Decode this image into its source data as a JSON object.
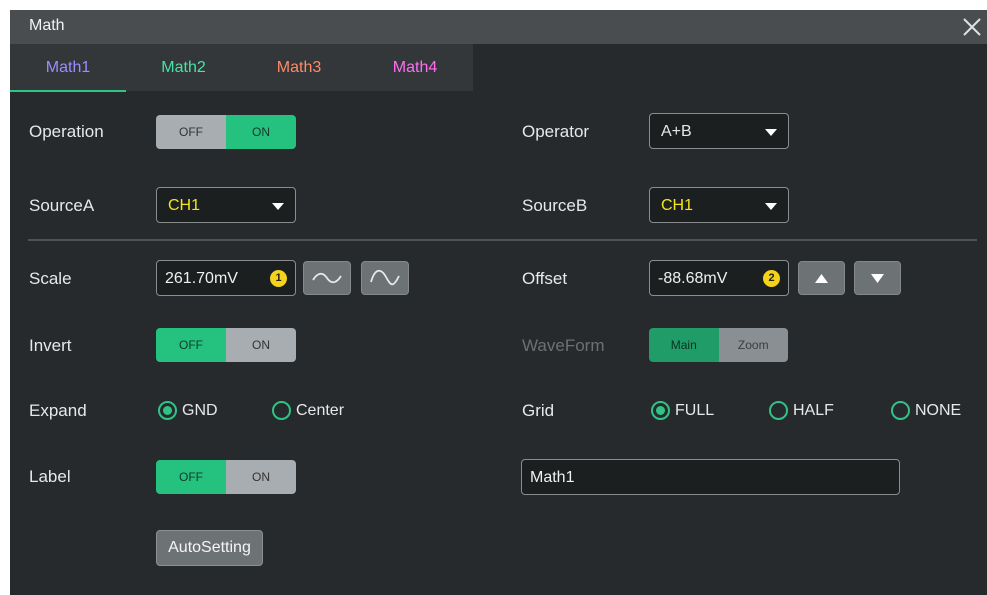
{
  "window": {
    "title": "Math"
  },
  "tabs": [
    {
      "label": "Math1",
      "color": "#9b8cff",
      "active": true
    },
    {
      "label": "Math2",
      "color": "#48e3a2"
    },
    {
      "label": "Math3",
      "color": "#ff8a66"
    },
    {
      "label": "Math4",
      "color": "#ff6ef2"
    }
  ],
  "operation": {
    "label": "Operation",
    "off": "OFF",
    "on": "ON",
    "state": "ON"
  },
  "operator": {
    "label": "Operator",
    "value": "A+B"
  },
  "sourceA": {
    "label": "SourceA",
    "value": "CH1",
    "value_color": "#f5e51c"
  },
  "sourceB": {
    "label": "SourceB",
    "value": "CH1",
    "value_color": "#f5e51c"
  },
  "scale": {
    "label": "Scale",
    "value": "261.70mV",
    "knob": "1"
  },
  "offset": {
    "label": "Offset",
    "value": "-88.68mV",
    "knob": "2"
  },
  "invert": {
    "label": "Invert",
    "off": "OFF",
    "on": "ON",
    "state": "OFF"
  },
  "waveform": {
    "label": "WaveForm",
    "main": "Main",
    "zoom": "Zoom",
    "state": "Main"
  },
  "expand": {
    "label": "Expand",
    "options": [
      "GND",
      "Center"
    ],
    "selected": "GND"
  },
  "grid": {
    "label": "Grid",
    "options": [
      "FULL",
      "HALF",
      "NONE"
    ],
    "selected": "FULL"
  },
  "label_row": {
    "label": "Label",
    "off": "OFF",
    "on": "ON",
    "state": "OFF",
    "text_value": "Math1"
  },
  "autosetting": {
    "label": "AutoSetting"
  },
  "colors": {
    "accent": "#2fc486",
    "panel": "#262a2c",
    "knob": "#f5d31a"
  }
}
